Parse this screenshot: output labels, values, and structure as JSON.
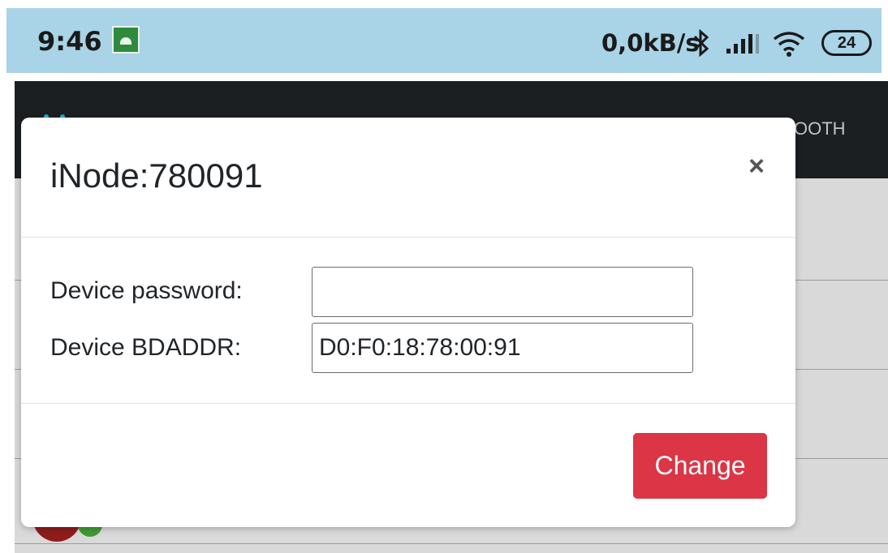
{
  "status_bar": {
    "time": "9:46",
    "app_icon": "android-icon",
    "net_speed": "0,0kB/s",
    "bluetooth_icon": "bluetooth-icon",
    "signal_icon": "signal-icon",
    "wifi_icon": "wifi-icon",
    "battery": "24",
    "background_color": "#a9d3e6"
  },
  "app": {
    "toolbar_menu_text": "OOTH",
    "toolbar_color": "#1c1f21"
  },
  "modal": {
    "title": "iNode:780091",
    "close_label": "×",
    "fields": {
      "password_label": "Device password:",
      "password_value": "",
      "bdaddr_label": "Device BDADDR:",
      "bdaddr_value": "D0:F0:18:78:00:91"
    },
    "change_button": "Change",
    "button_color": "#dc3545"
  }
}
